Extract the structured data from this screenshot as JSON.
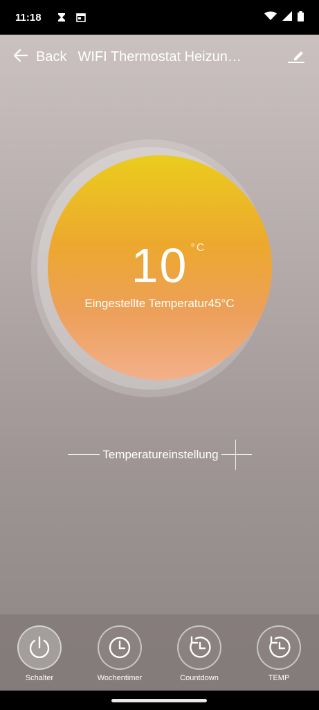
{
  "status": {
    "time": "11:18"
  },
  "appbar": {
    "back_label": "Back",
    "title": "WIFI Thermostat Heizung…"
  },
  "dial": {
    "current_temp": "10",
    "unit": "°C",
    "set_label": "Eingestellte Temperatur45°C"
  },
  "adjust": {
    "label": "Temperatureinstellung"
  },
  "tabs": [
    {
      "label": "Schalter",
      "icon": "power-icon"
    },
    {
      "label": "Wochentimer",
      "icon": "clock-icon"
    },
    {
      "label": "Countdown",
      "icon": "countdown-icon"
    },
    {
      "label": "TEMP",
      "icon": "countdown-icon"
    }
  ],
  "colors": {
    "dial_top": "#ebcc1d",
    "dial_mid": "#eca82e",
    "dial_bottom": "#f3b08a"
  }
}
